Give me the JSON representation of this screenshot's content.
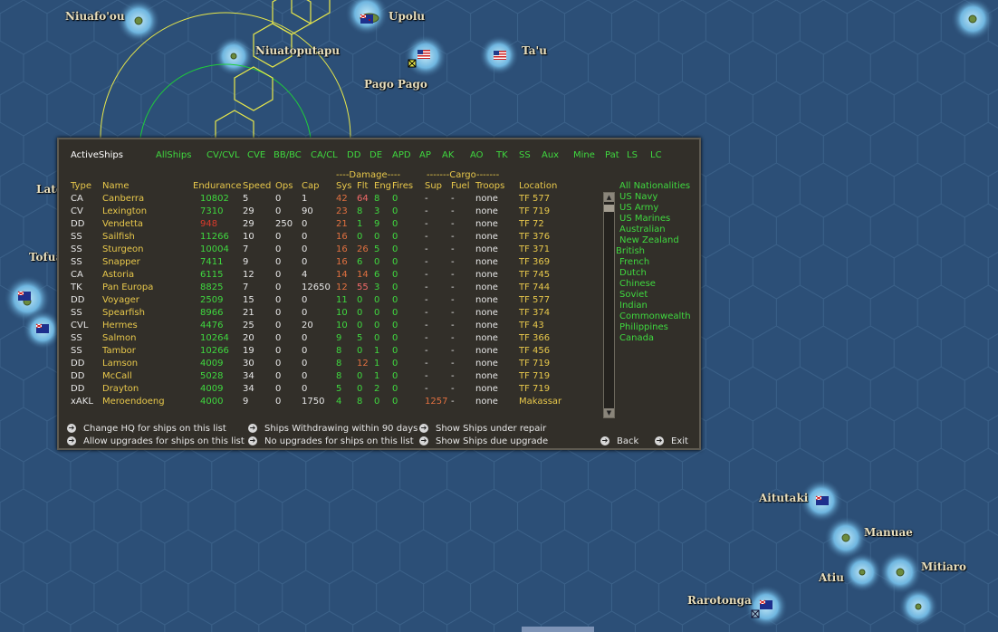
{
  "map": {
    "places": [
      {
        "name": "Niuafo'ou"
      },
      {
        "name": "Upolu"
      },
      {
        "name": "Niuatoputapu"
      },
      {
        "name": "Ta'u"
      },
      {
        "name": "Pago Pago"
      },
      {
        "name": "Late"
      },
      {
        "name": "Tofua"
      },
      {
        "name": "Aitutaki"
      },
      {
        "name": "Manuae"
      },
      {
        "name": "Mitiaro"
      },
      {
        "name": "Atiu"
      },
      {
        "name": "Rarotonga"
      }
    ]
  },
  "panel": {
    "tabs": [
      "ActiveShips",
      "AllShips",
      "CV/CVL",
      "CVE",
      "BB/BC",
      "CA/CL",
      "DD",
      "DE",
      "APD",
      "AP",
      "AK",
      "AO",
      "TK",
      "SS",
      "Aux",
      "Mine",
      "Pat",
      "LS",
      "LC"
    ],
    "group_headers": {
      "damage": "----Damage----",
      "cargo": "-------Cargo-------"
    },
    "columns": [
      "Type",
      "Name",
      "Endurance",
      "Speed",
      "Ops",
      "Cap",
      "Sys",
      "Flt",
      "Eng",
      "Fires",
      "Sup",
      "Fuel",
      "Troops",
      "Location"
    ],
    "ships": [
      {
        "type": "CA",
        "name": "Canberra",
        "endurance": "10802",
        "speed": "5",
        "ops": "0",
        "cap": "1",
        "sys": "42",
        "flt": "64",
        "eng": "8",
        "fires": "0",
        "sup": "-",
        "fuel": "-",
        "troops": "none",
        "location": "TF 577"
      },
      {
        "type": "CV",
        "name": "Lexington",
        "endurance": "7310",
        "speed": "29",
        "ops": "0",
        "cap": "90",
        "sys": "23",
        "flt": "8",
        "eng": "3",
        "fires": "0",
        "sup": "-",
        "fuel": "-",
        "troops": "none",
        "location": "TF 719"
      },
      {
        "type": "DD",
        "name": "Vendetta",
        "endurance": "948",
        "speed": "29",
        "ops": "250",
        "cap": "0",
        "sys": "21",
        "flt": "1",
        "eng": "9",
        "fires": "0",
        "sup": "-",
        "fuel": "-",
        "troops": "none",
        "location": "TF 72"
      },
      {
        "type": "SS",
        "name": "Sailfish",
        "endurance": "11266",
        "speed": "10",
        "ops": "0",
        "cap": "0",
        "sys": "16",
        "flt": "0",
        "eng": "0",
        "fires": "0",
        "sup": "-",
        "fuel": "-",
        "troops": "none",
        "location": "TF 376"
      },
      {
        "type": "SS",
        "name": "Sturgeon",
        "endurance": "10004",
        "speed": "7",
        "ops": "0",
        "cap": "0",
        "sys": "16",
        "flt": "26",
        "eng": "5",
        "fires": "0",
        "sup": "-",
        "fuel": "-",
        "troops": "none",
        "location": "TF 371"
      },
      {
        "type": "SS",
        "name": "Snapper",
        "endurance": "7411",
        "speed": "9",
        "ops": "0",
        "cap": "0",
        "sys": "16",
        "flt": "6",
        "eng": "0",
        "fires": "0",
        "sup": "-",
        "fuel": "-",
        "troops": "none",
        "location": "TF 369"
      },
      {
        "type": "CA",
        "name": "Astoria",
        "endurance": "6115",
        "speed": "12",
        "ops": "0",
        "cap": "4",
        "sys": "14",
        "flt": "14",
        "eng": "6",
        "fires": "0",
        "sup": "-",
        "fuel": "-",
        "troops": "none",
        "location": "TF 745"
      },
      {
        "type": "TK",
        "name": "Pan Europa",
        "endurance": "8825",
        "speed": "7",
        "ops": "0",
        "cap": "12650",
        "sys": "12",
        "flt": "55",
        "eng": "3",
        "fires": "0",
        "sup": "-",
        "fuel": "-",
        "troops": "none",
        "location": "TF 744"
      },
      {
        "type": "DD",
        "name": "Voyager",
        "endurance": "2509",
        "speed": "15",
        "ops": "0",
        "cap": "0",
        "sys": "11",
        "flt": "0",
        "eng": "0",
        "fires": "0",
        "sup": "-",
        "fuel": "-",
        "troops": "none",
        "location": "TF 577"
      },
      {
        "type": "SS",
        "name": "Spearfish",
        "endurance": "8966",
        "speed": "21",
        "ops": "0",
        "cap": "0",
        "sys": "10",
        "flt": "0",
        "eng": "0",
        "fires": "0",
        "sup": "-",
        "fuel": "-",
        "troops": "none",
        "location": "TF 374"
      },
      {
        "type": "CVL",
        "name": "Hermes",
        "endurance": "4476",
        "speed": "25",
        "ops": "0",
        "cap": "20",
        "sys": "10",
        "flt": "0",
        "eng": "0",
        "fires": "0",
        "sup": "-",
        "fuel": "-",
        "troops": "none",
        "location": "TF 43"
      },
      {
        "type": "SS",
        "name": "Salmon",
        "endurance": "10264",
        "speed": "20",
        "ops": "0",
        "cap": "0",
        "sys": "9",
        "flt": "5",
        "eng": "0",
        "fires": "0",
        "sup": "-",
        "fuel": "-",
        "troops": "none",
        "location": "TF 366"
      },
      {
        "type": "SS",
        "name": "Tambor",
        "endurance": "10266",
        "speed": "19",
        "ops": "0",
        "cap": "0",
        "sys": "8",
        "flt": "0",
        "eng": "1",
        "fires": "0",
        "sup": "-",
        "fuel": "-",
        "troops": "none",
        "location": "TF 456"
      },
      {
        "type": "DD",
        "name": "Lamson",
        "endurance": "4009",
        "speed": "30",
        "ops": "0",
        "cap": "0",
        "sys": "8",
        "flt": "12",
        "eng": "1",
        "fires": "0",
        "sup": "-",
        "fuel": "-",
        "troops": "none",
        "location": "TF 719"
      },
      {
        "type": "DD",
        "name": "McCall",
        "endurance": "5028",
        "speed": "34",
        "ops": "0",
        "cap": "0",
        "sys": "8",
        "flt": "0",
        "eng": "1",
        "fires": "0",
        "sup": "-",
        "fuel": "-",
        "troops": "none",
        "location": "TF 719"
      },
      {
        "type": "DD",
        "name": "Drayton",
        "endurance": "4009",
        "speed": "34",
        "ops": "0",
        "cap": "0",
        "sys": "5",
        "flt": "0",
        "eng": "2",
        "fires": "0",
        "sup": "-",
        "fuel": "-",
        "troops": "none",
        "location": "TF 719"
      },
      {
        "type": "xAKL",
        "name": "Meroendoeng",
        "endurance": "4000",
        "speed": "9",
        "ops": "0",
        "cap": "1750",
        "sys": "4",
        "flt": "8",
        "eng": "0",
        "fires": "0",
        "sup": "1257",
        "fuel": "-",
        "troops": "none",
        "location": "Makassar"
      }
    ],
    "nationalities": [
      "All Nationalities",
      "US Navy",
      "US Army",
      "US Marines",
      "Australian",
      "New Zealand",
      "British",
      "French",
      "Dutch",
      "Chinese",
      "Soviet",
      "Indian",
      "Commonwealth",
      "Philippines",
      "Canada"
    ],
    "commands": {
      "change_hq": "Change HQ for ships on this list",
      "allow_upgrades": "Allow upgrades for ships on this list",
      "withdrawing": "Ships Withdrawing within 90 days",
      "no_upgrades": "No upgrades for ships on this list",
      "under_repair": "Show Ships under repair",
      "due_upgrade": "Show Ships due upgrade",
      "back": "Back",
      "exit": "Exit"
    },
    "colors": {
      "panel_bg": "#322f29",
      "green": "#3fd83f",
      "yellow": "#e8c84b",
      "red": "#d93a2b",
      "white": "#e6e6e6"
    }
  }
}
